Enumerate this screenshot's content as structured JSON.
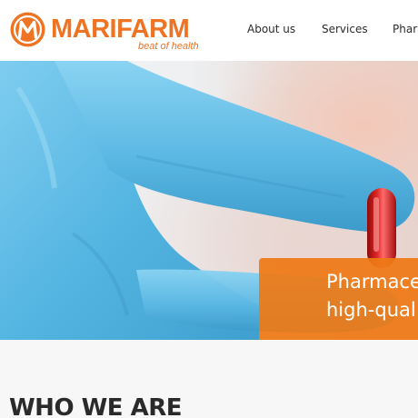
{
  "header": {
    "logo": {
      "brand": "MARIFARM",
      "tagline": "beat of health",
      "icon": "m-circle-logo-icon"
    },
    "nav": [
      {
        "label": "About us"
      },
      {
        "label": "Services"
      },
      {
        "label": "Pharm"
      }
    ]
  },
  "hero": {
    "image": "gloved-hand-holding-red-capsule",
    "caption_lines": [
      "Pharmace",
      "high-qual"
    ]
  },
  "section": {
    "title": "WHO WE ARE"
  },
  "colors": {
    "brand_orange": "#ee7322",
    "caption_bg": "#ee7a16",
    "glove_blue": "#5cb9e4",
    "capsule_red": "#d41b1b",
    "section_bg": "#f7f7f7"
  }
}
